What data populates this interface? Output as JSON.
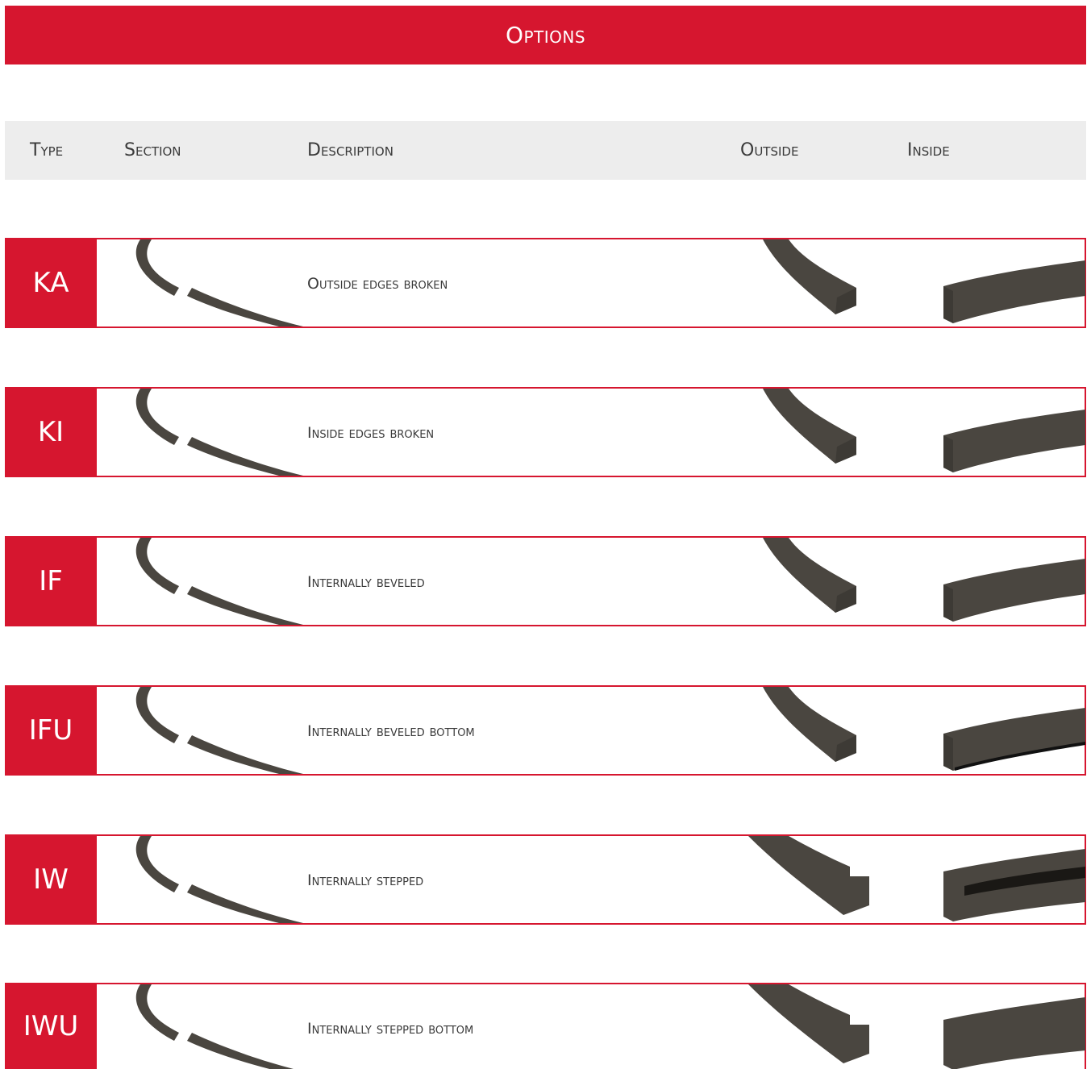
{
  "banner": {
    "title": "Options"
  },
  "header": {
    "type": "Type",
    "section": "Section",
    "description": "Description",
    "outside": "Outside",
    "inside": "Inside"
  },
  "colors": {
    "accent": "#d6162f",
    "header_bg": "#ededed",
    "ring": "#4a4640"
  },
  "rows": [
    {
      "code": "KA",
      "description": "Outside edges broken"
    },
    {
      "code": "KI",
      "description": "Inside edges broken"
    },
    {
      "code": "IF",
      "description": "Internally beveled"
    },
    {
      "code": "IFU",
      "description": "Internally beveled bottom"
    },
    {
      "code": "IW",
      "description": "Internally stepped"
    },
    {
      "code": "IWU",
      "description": "Internally stepped bottom"
    }
  ]
}
